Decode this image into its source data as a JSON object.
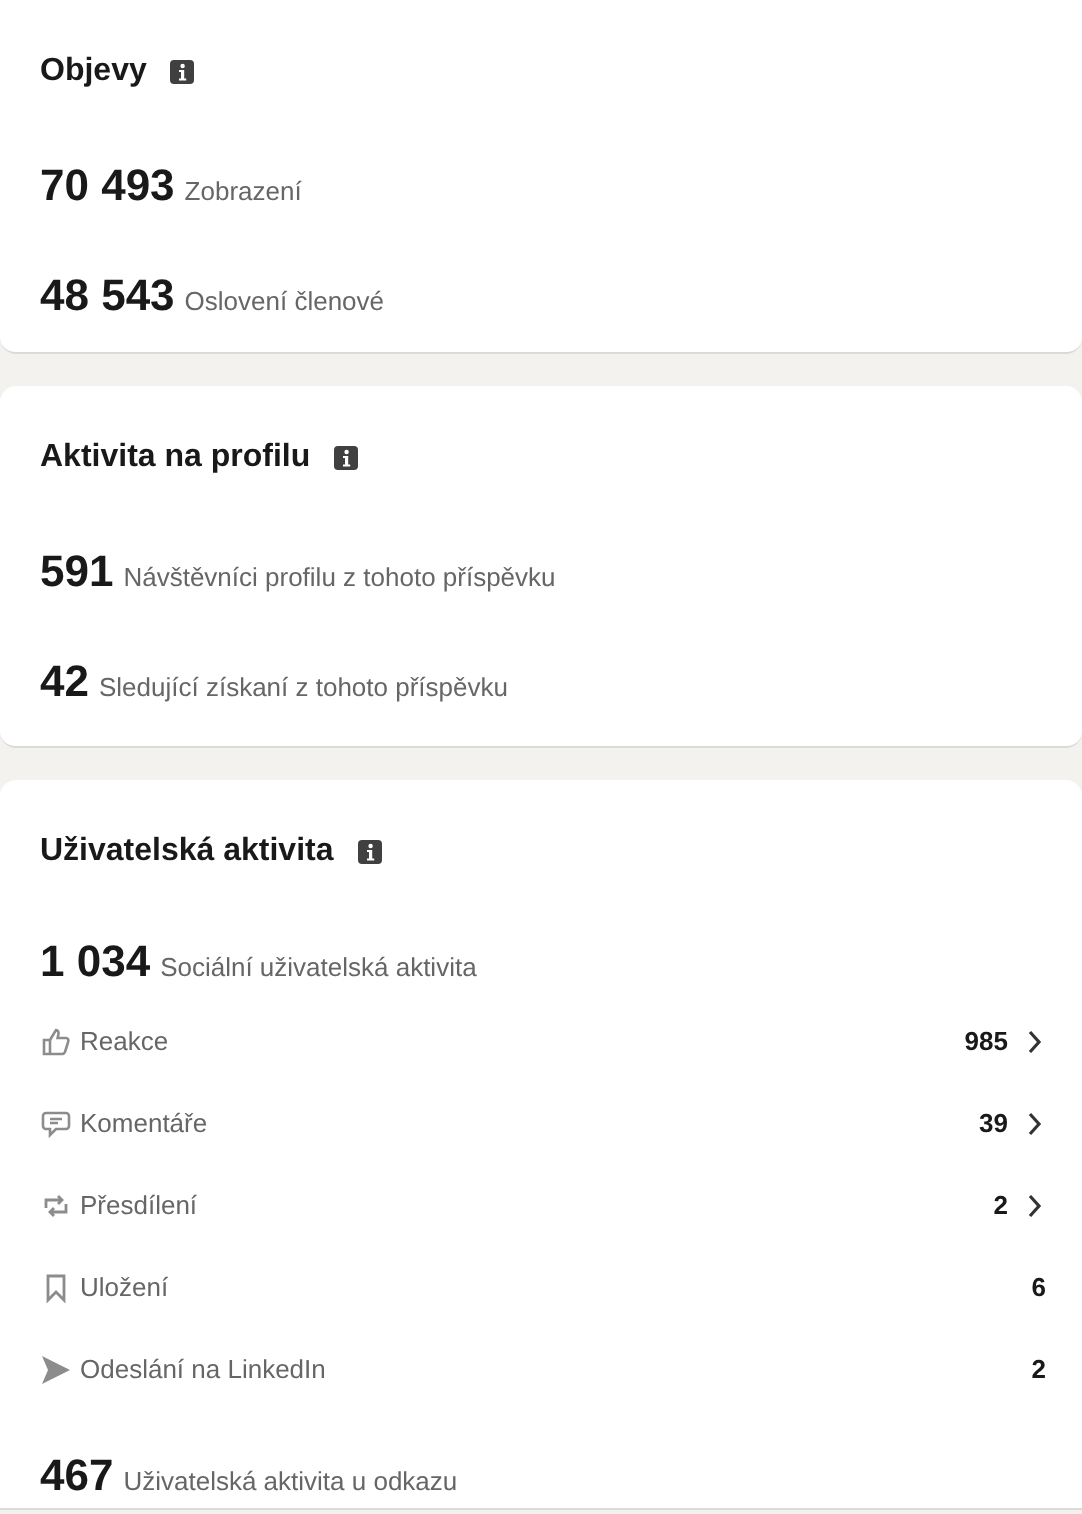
{
  "sections": [
    {
      "title": "Objevy",
      "metrics": [
        {
          "value": "70 493",
          "label": "Zobrazení"
        },
        {
          "value": "48 543",
          "label": "Oslovení členové"
        }
      ]
    },
    {
      "title": "Aktivita na profilu",
      "metrics": [
        {
          "value": "591",
          "label": "Návštěvníci profilu z tohoto příspěvku"
        },
        {
          "value": "42",
          "label": "Sledující získaní z tohoto příspěvku"
        }
      ]
    },
    {
      "title": "Uživatelská aktivita",
      "metrics": [
        {
          "value": "1 034",
          "label": "Sociální uživatelská aktivita"
        }
      ],
      "rows": [
        {
          "kind": "reaction",
          "label": "Reakce",
          "value": "985",
          "expandable": true
        },
        {
          "kind": "comment",
          "label": "Komentáře",
          "value": "39",
          "expandable": true
        },
        {
          "kind": "repost",
          "label": "Přesdílení",
          "value": "2",
          "expandable": true
        },
        {
          "kind": "save",
          "label": "Uložení",
          "value": "6",
          "expandable": false
        },
        {
          "kind": "send",
          "label": "Odeslání na LinkedIn",
          "value": "2",
          "expandable": false
        }
      ],
      "footer_metrics": [
        {
          "value": "467",
          "label": "Uživatelská aktivita u odkazu"
        }
      ]
    }
  ]
}
